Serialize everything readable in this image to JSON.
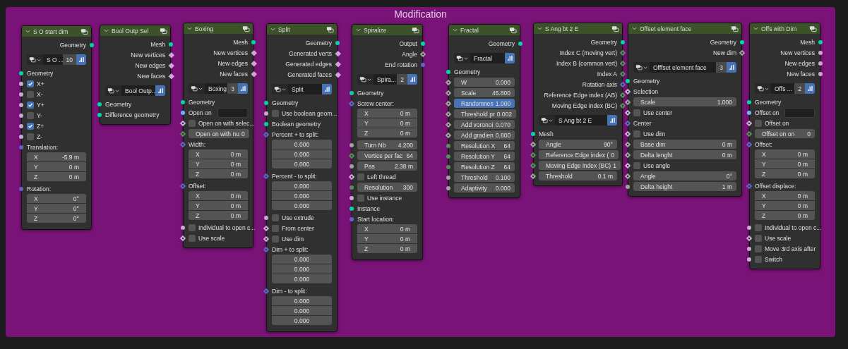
{
  "frame": {
    "title": "Modification"
  },
  "nodes": [
    {
      "title": "S O start dim",
      "rows": [
        {
          "kind": "output",
          "label": "Geometry",
          "socket": {
            "kind": "circle",
            "color": "#00d6a3"
          }
        },
        {
          "kind": "selector",
          "name": "S O ...",
          "count": "10"
        },
        {
          "kind": "input",
          "label": "Geometry",
          "socket": {
            "kind": "circle",
            "color": "#00d6a3"
          }
        },
        {
          "kind": "check",
          "label": "X+",
          "checked": true,
          "socket": {
            "kind": "circle",
            "color": "#cca6d6"
          }
        },
        {
          "kind": "check",
          "label": "X-",
          "checked": false,
          "socket": {
            "kind": "circle",
            "color": "#cca6d6"
          }
        },
        {
          "kind": "check",
          "label": "Y+",
          "checked": true,
          "socket": {
            "kind": "circle",
            "color": "#cca6d6"
          }
        },
        {
          "kind": "check",
          "label": "Y-",
          "checked": false,
          "socket": {
            "kind": "circle",
            "color": "#cca6d6"
          }
        },
        {
          "kind": "check",
          "label": "Z+",
          "checked": true,
          "socket": {
            "kind": "circle",
            "color": "#cca6d6"
          }
        },
        {
          "kind": "check",
          "label": "Z-",
          "checked": false,
          "socket": {
            "kind": "circle",
            "color": "#cca6d6"
          }
        },
        {
          "kind": "vector",
          "label": "Translation:",
          "socket": {
            "kind": "circle",
            "color": "#6363c7"
          },
          "items": [
            {
              "axis": "X",
              "value": "-5.9 m"
            },
            {
              "axis": "Y",
              "value": "0 m"
            },
            {
              "axis": "Z",
              "value": "0 m"
            }
          ]
        },
        {
          "kind": "vector",
          "label": "Rotation:",
          "socket": {
            "kind": "circle",
            "color": "#6363c7"
          },
          "items": [
            {
              "axis": "X",
              "value": "0°"
            },
            {
              "axis": "Y",
              "value": "0°"
            },
            {
              "axis": "Z",
              "value": "0°"
            }
          ]
        }
      ]
    },
    {
      "title": "Bool Outp Sel",
      "rows": [
        {
          "kind": "output",
          "label": "Mesh",
          "socket": {
            "kind": "circle",
            "color": "#00d6a3"
          }
        },
        {
          "kind": "output",
          "label": "New vertices",
          "socket": {
            "kind": "diamond",
            "color": "#cca6d6"
          }
        },
        {
          "kind": "output",
          "label": "New edges",
          "socket": {
            "kind": "diamond",
            "color": "#cca6d6"
          }
        },
        {
          "kind": "output",
          "label": "New faces",
          "socket": {
            "kind": "diamond",
            "color": "#cca6d6"
          }
        },
        {
          "kind": "selector",
          "name": "Bool Outp..."
        },
        {
          "kind": "input",
          "label": "Geometry",
          "socket": {
            "kind": "circle",
            "color": "#00d6a3"
          }
        },
        {
          "kind": "input",
          "label": "Difference geometry",
          "socket": {
            "kind": "circle",
            "color": "#00d6a3"
          }
        }
      ]
    },
    {
      "title": "Boxing",
      "rows": [
        {
          "kind": "output",
          "label": "Mesh",
          "socket": {
            "kind": "circle",
            "color": "#00d6a3"
          }
        },
        {
          "kind": "output",
          "label": "New vertices",
          "socket": {
            "kind": "diamond",
            "color": "#cca6d6"
          }
        },
        {
          "kind": "output",
          "label": "New edges",
          "socket": {
            "kind": "diamond",
            "color": "#cca6d6"
          }
        },
        {
          "kind": "output",
          "label": "New faces",
          "socket": {
            "kind": "diamond",
            "color": "#cca6d6"
          }
        },
        {
          "kind": "selector",
          "name": "Boxing",
          "count": "3"
        },
        {
          "kind": "input",
          "label": "Geometry",
          "socket": {
            "kind": "circle",
            "color": "#00d6a3"
          }
        },
        {
          "kind": "text",
          "label": "Open on",
          "socket": {
            "kind": "circle",
            "color": "#70b2ff"
          }
        },
        {
          "kind": "check",
          "label": "Open on with selec...",
          "checked": false,
          "socket": {
            "kind": "field",
            "color": "#cca6d6"
          }
        },
        {
          "kind": "field",
          "label": "Open on with nu",
          "value": "0",
          "selected": false,
          "socket": {
            "kind": "field",
            "color": "#598c5c"
          }
        },
        {
          "kind": "vector",
          "label": "Width:",
          "socket": {
            "kind": "field",
            "color": "#6363c7"
          },
          "items": [
            {
              "axis": "X",
              "value": "0 m"
            },
            {
              "axis": "Y",
              "value": "0 m"
            },
            {
              "axis": "Z",
              "value": "0 m"
            }
          ]
        },
        {
          "kind": "vector",
          "label": "Offset:",
          "socket": {
            "kind": "field",
            "color": "#6363c7"
          },
          "items": [
            {
              "axis": "X",
              "value": "0 m"
            },
            {
              "axis": "Y",
              "value": "0 m"
            },
            {
              "axis": "Z",
              "value": "0 m"
            }
          ]
        },
        {
          "kind": "check",
          "label": "Individual to open c...",
          "checked": false,
          "socket": {
            "kind": "circle",
            "color": "#cca6d6"
          }
        },
        {
          "kind": "check",
          "label": "Use scale",
          "checked": false,
          "socket": {
            "kind": "field",
            "color": "#cca6d6"
          }
        }
      ]
    },
    {
      "title": "Split",
      "rows": [
        {
          "kind": "output",
          "label": "Geometry",
          "socket": {
            "kind": "circle",
            "color": "#00d6a3"
          }
        },
        {
          "kind": "output",
          "label": "Generated verts",
          "socket": {
            "kind": "diamond",
            "color": "#cca6d6"
          }
        },
        {
          "kind": "output",
          "label": "Generated edges",
          "socket": {
            "kind": "diamond",
            "color": "#cca6d6"
          }
        },
        {
          "kind": "output",
          "label": "Generated faces",
          "socket": {
            "kind": "diamond",
            "color": "#cca6d6"
          }
        },
        {
          "kind": "selector",
          "name": "Split"
        },
        {
          "kind": "input",
          "label": "Geometry",
          "socket": {
            "kind": "circle",
            "color": "#00d6a3"
          }
        },
        {
          "kind": "check",
          "label": "Use boolean geom...",
          "checked": false,
          "socket": {
            "kind": "circle",
            "color": "#cca6d6"
          }
        },
        {
          "kind": "input",
          "label": "Boolean geometry",
          "socket": {
            "kind": "circle",
            "color": "#00d6a3"
          }
        },
        {
          "kind": "vector",
          "label": "Percent + to split:",
          "socket": {
            "kind": "field",
            "color": "#6363c7"
          },
          "items": [
            {
              "value": "0.000"
            },
            {
              "value": "0.000"
            },
            {
              "value": "0.000"
            }
          ]
        },
        {
          "kind": "vector",
          "label": "Percent - to split:",
          "socket": {
            "kind": "field",
            "color": "#6363c7"
          },
          "items": [
            {
              "value": "0.000"
            },
            {
              "value": "0.000"
            },
            {
              "value": "0.000"
            }
          ]
        },
        {
          "kind": "check",
          "label": "Use extrude",
          "checked": false,
          "socket": {
            "kind": "circle",
            "color": "#cca6d6"
          }
        },
        {
          "kind": "check",
          "label": "From center",
          "checked": false,
          "socket": {
            "kind": "field",
            "color": "#cca6d6"
          }
        },
        {
          "kind": "check",
          "label": "Use dim",
          "checked": false,
          "socket": {
            "kind": "field",
            "color": "#cca6d6"
          }
        },
        {
          "kind": "vector",
          "label": "Dim + to split:",
          "socket": {
            "kind": "field",
            "color": "#6363c7"
          },
          "items": [
            {
              "value": "0.000"
            },
            {
              "value": "0.000"
            },
            {
              "value": "0.000"
            }
          ]
        },
        {
          "kind": "vector",
          "label": "Dim - to split:",
          "socket": {
            "kind": "field",
            "color": "#6363c7"
          },
          "items": [
            {
              "value": "0.000"
            },
            {
              "value": "0.000"
            },
            {
              "value": "0.000"
            }
          ]
        }
      ]
    },
    {
      "title": "Spiralize",
      "rows": [
        {
          "kind": "output",
          "label": "Output",
          "socket": {
            "kind": "circle",
            "color": "#00d6a3"
          }
        },
        {
          "kind": "output",
          "label": "Angle",
          "socket": {
            "kind": "field",
            "color": "#a1a1a1"
          }
        },
        {
          "kind": "output",
          "label": "End rotation",
          "socket": {
            "kind": "circle",
            "color": "#6363c7"
          }
        },
        {
          "kind": "selector",
          "name": "Spira...",
          "count": "2"
        },
        {
          "kind": "input",
          "label": "Geometry",
          "socket": {
            "kind": "circle",
            "color": "#00d6a3"
          }
        },
        {
          "kind": "vector",
          "label": "Screw center:",
          "socket": {
            "kind": "field",
            "color": "#6363c7"
          },
          "items": [
            {
              "axis": "X",
              "value": "0 m"
            },
            {
              "axis": "Y",
              "value": "0 m"
            },
            {
              "axis": "Z",
              "value": "0 m"
            }
          ]
        },
        {
          "kind": "field",
          "label": "Turn Nb",
          "value": "4.200",
          "selected": false,
          "socket": {
            "kind": "circle",
            "color": "#a1a1a1"
          }
        },
        {
          "kind": "field",
          "label": "Vertice per fac",
          "value": "64",
          "selected": false,
          "socket": {
            "kind": "field",
            "color": "#598c5c"
          }
        },
        {
          "kind": "field",
          "label": "Pas",
          "value": "2.38 m",
          "selected": false,
          "socket": {
            "kind": "circle",
            "color": "#a1a1a1"
          }
        },
        {
          "kind": "check",
          "label": "Left thread",
          "checked": false,
          "socket": {
            "kind": "field",
            "color": "#cca6d6"
          }
        },
        {
          "kind": "field",
          "label": "Resolution",
          "value": "300",
          "selected": false,
          "socket": {
            "kind": "circle",
            "color": "#598c5c"
          }
        },
        {
          "kind": "check",
          "label": "Use instance",
          "checked": false,
          "socket": {
            "kind": "circle",
            "color": "#cca6d6"
          }
        },
        {
          "kind": "input",
          "label": "Instance",
          "socket": {
            "kind": "circle",
            "color": "#00d6a3"
          }
        },
        {
          "kind": "vector",
          "label": "Start location:",
          "socket": {
            "kind": "circle",
            "color": "#6363c7"
          },
          "items": [
            {
              "axis": "X",
              "value": "0 m"
            },
            {
              "axis": "Y",
              "value": "0 m"
            },
            {
              "axis": "Z",
              "value": "0 m"
            }
          ]
        }
      ]
    },
    {
      "title": "Fractal",
      "rows": [
        {
          "kind": "output",
          "label": "Geometry",
          "socket": {
            "kind": "circle",
            "color": "#00d6a3"
          }
        },
        {
          "kind": "selector",
          "name": "Fractal"
        },
        {
          "kind": "input",
          "label": "Geometry",
          "socket": {
            "kind": "circle",
            "color": "#00d6a3"
          }
        },
        {
          "kind": "field",
          "label": "W",
          "value": "0.000",
          "selected": false,
          "socket": {
            "kind": "field",
            "color": "#a1a1a1"
          }
        },
        {
          "kind": "field",
          "label": "Scale",
          "value": "45.800",
          "selected": false,
          "socket": {
            "kind": "field",
            "color": "#a1a1a1"
          }
        },
        {
          "kind": "field",
          "label": "Randomnes",
          "value": "1.000",
          "selected": true,
          "socket": {
            "kind": "field",
            "color": "#a1a1a1"
          }
        },
        {
          "kind": "field",
          "label": "Threshold pr",
          "value": "0.002",
          "selected": false,
          "socket": {
            "kind": "field",
            "color": "#a1a1a1"
          }
        },
        {
          "kind": "field",
          "label": "Add voronoi",
          "value": "0.070",
          "selected": false,
          "socket": {
            "kind": "field",
            "color": "#a1a1a1"
          }
        },
        {
          "kind": "field",
          "label": "Add gradien",
          "value": "0.800",
          "selected": false,
          "socket": {
            "kind": "field",
            "color": "#a1a1a1"
          }
        },
        {
          "kind": "field",
          "label": "Resolution X",
          "value": "64",
          "selected": false,
          "socket": {
            "kind": "circle",
            "color": "#598c5c"
          }
        },
        {
          "kind": "field",
          "label": "Resolution Y",
          "value": "64",
          "selected": false,
          "socket": {
            "kind": "circle",
            "color": "#598c5c"
          }
        },
        {
          "kind": "field",
          "label": "Resolution Z",
          "value": "64",
          "selected": false,
          "socket": {
            "kind": "circle",
            "color": "#598c5c"
          }
        },
        {
          "kind": "field",
          "label": "Threshold",
          "value": "0.100",
          "selected": false,
          "socket": {
            "kind": "circle",
            "color": "#a1a1a1"
          }
        },
        {
          "kind": "field",
          "label": "Adaptivity",
          "value": "0.000",
          "selected": false,
          "socket": {
            "kind": "circle",
            "color": "#a1a1a1"
          }
        }
      ]
    },
    {
      "title": "S Ang bt 2 E",
      "rows": [
        {
          "kind": "output",
          "label": "Geometry",
          "socket": {
            "kind": "circle",
            "color": "#00d6a3"
          }
        },
        {
          "kind": "output",
          "label": "Index C (moving vert)",
          "socket": {
            "kind": "field",
            "color": "#598c5c"
          }
        },
        {
          "kind": "output",
          "label": "Index B (common vert)",
          "socket": {
            "kind": "field",
            "color": "#598c5c"
          }
        },
        {
          "kind": "output",
          "label": "Index A",
          "socket": {
            "kind": "field",
            "color": "#598c5c"
          }
        },
        {
          "kind": "output",
          "label": "Rotation axis",
          "socket": {
            "kind": "field",
            "color": "#6363c7"
          }
        },
        {
          "kind": "output",
          "label": "Reference Edge index (AB)",
          "socket": {
            "kind": "field",
            "color": "#598c5c"
          }
        },
        {
          "kind": "output",
          "label": "Moving Edge index (BC)",
          "socket": {
            "kind": "field",
            "color": "#598c5c"
          }
        },
        {
          "kind": "selector",
          "name": "S Ang bt 2 E"
        },
        {
          "kind": "input",
          "label": "Mesh",
          "socket": {
            "kind": "circle",
            "color": "#00d6a3"
          }
        },
        {
          "kind": "field",
          "label": "Angle",
          "value": "90°",
          "selected": false,
          "socket": {
            "kind": "field",
            "color": "#a1a1a1"
          }
        },
        {
          "kind": "field",
          "label": "Reference Edge index (",
          "value": "0",
          "selected": false,
          "socket": {
            "kind": "field",
            "color": "#598c5c"
          }
        },
        {
          "kind": "field",
          "label": "Moving Edge index (BC)",
          "value": "1",
          "selected": false,
          "socket": {
            "kind": "field",
            "color": "#598c5c"
          }
        },
        {
          "kind": "field",
          "label": "Threshold",
          "value": "0.1 m",
          "selected": false,
          "socket": {
            "kind": "field",
            "color": "#a1a1a1"
          }
        }
      ]
    },
    {
      "title": "Offset element face",
      "rows": [
        {
          "kind": "output",
          "label": "Geometry",
          "socket": {
            "kind": "circle",
            "color": "#00d6a3"
          }
        },
        {
          "kind": "output",
          "label": "New dim",
          "socket": {
            "kind": "field",
            "color": "#a1a1a1"
          }
        },
        {
          "kind": "selector",
          "name": "Offfset element face",
          "count": "3"
        },
        {
          "kind": "input",
          "label": "Geometry",
          "socket": {
            "kind": "circle",
            "color": "#00d6a3"
          }
        },
        {
          "kind": "input",
          "label": "Selection",
          "socket": {
            "kind": "field",
            "color": "#cca6d6"
          }
        },
        {
          "kind": "field",
          "label": "Scale",
          "value": "1.000",
          "selected": false,
          "socket": {
            "kind": "field",
            "color": "#a1a1a1"
          }
        },
        {
          "kind": "check",
          "label": "Use center",
          "checked": false,
          "socket": {
            "kind": "field",
            "color": "#cca6d6"
          }
        },
        {
          "kind": "input",
          "label": "Center",
          "socket": {
            "kind": "field",
            "color": "#6363c7"
          }
        },
        {
          "kind": "check",
          "label": "Use dim",
          "checked": false,
          "socket": {
            "kind": "field",
            "color": "#cca6d6"
          }
        },
        {
          "kind": "field",
          "label": "Base dim",
          "value": "0 m",
          "selected": false,
          "socket": {
            "kind": "field",
            "color": "#a1a1a1"
          }
        },
        {
          "kind": "field",
          "label": "Delta lenght",
          "value": "0 m",
          "selected": false,
          "socket": {
            "kind": "field",
            "color": "#a1a1a1"
          }
        },
        {
          "kind": "check",
          "label": "Use angle",
          "checked": false,
          "socket": {
            "kind": "field",
            "color": "#cca6d6"
          }
        },
        {
          "kind": "field",
          "label": "Angle",
          "value": "0°",
          "selected": false,
          "socket": {
            "kind": "field",
            "color": "#a1a1a1"
          }
        },
        {
          "kind": "field",
          "label": "Delta height",
          "value": "1 m",
          "selected": false,
          "socket": {
            "kind": "circle",
            "color": "#a1a1a1"
          }
        }
      ]
    },
    {
      "title": "Offs with Dim",
      "rows": [
        {
          "kind": "output",
          "label": "Mesh",
          "socket": {
            "kind": "circle",
            "color": "#00d6a3"
          }
        },
        {
          "kind": "output",
          "label": "New vertices",
          "socket": {
            "kind": "circle",
            "color": "#cca6d6"
          }
        },
        {
          "kind": "output",
          "label": "New edges",
          "socket": {
            "kind": "circle",
            "color": "#cca6d6"
          }
        },
        {
          "kind": "output",
          "label": "New faces",
          "socket": {
            "kind": "circle",
            "color": "#cca6d6"
          }
        },
        {
          "kind": "selector",
          "name": "Offs ...",
          "count": "2"
        },
        {
          "kind": "input",
          "label": "Geometry",
          "socket": {
            "kind": "circle",
            "color": "#00d6a3"
          }
        },
        {
          "kind": "text",
          "label": "Offset on",
          "socket": {
            "kind": "circle",
            "color": "#70b2ff"
          }
        },
        {
          "kind": "check",
          "label": "Offset on",
          "checked": false,
          "socket": {
            "kind": "field",
            "color": "#cca6d6"
          }
        },
        {
          "kind": "field",
          "label": "Offset on on",
          "value": "0",
          "selected": false,
          "socket": {
            "kind": "field",
            "color": "#598c5c"
          }
        },
        {
          "kind": "vector",
          "label": "Offset:",
          "socket": {
            "kind": "field",
            "color": "#6363c7"
          },
          "items": [
            {
              "axis": "X",
              "value": "0 m"
            },
            {
              "axis": "Y",
              "value": "0 m"
            },
            {
              "axis": "Z",
              "value": "0 m"
            }
          ]
        },
        {
          "kind": "vector",
          "label": "Offset displace:",
          "socket": {
            "kind": "field",
            "color": "#6363c7"
          },
          "items": [
            {
              "axis": "X",
              "value": "0 m"
            },
            {
              "axis": "Y",
              "value": "0 m"
            },
            {
              "axis": "Z",
              "value": "0 m"
            }
          ]
        },
        {
          "kind": "check",
          "label": "Individual to open c...",
          "checked": false,
          "socket": {
            "kind": "circle",
            "color": "#cca6d6"
          }
        },
        {
          "kind": "check",
          "label": "Use scale",
          "checked": false,
          "socket": {
            "kind": "field",
            "color": "#cca6d6"
          }
        },
        {
          "kind": "check",
          "label": "Move 3rd axis after",
          "checked": false,
          "socket": {
            "kind": "circle",
            "color": "#cca6d6"
          }
        },
        {
          "kind": "check",
          "label": "Switch",
          "checked": false,
          "socket": {
            "kind": "circle",
            "color": "#cca6d6"
          }
        }
      ]
    }
  ]
}
